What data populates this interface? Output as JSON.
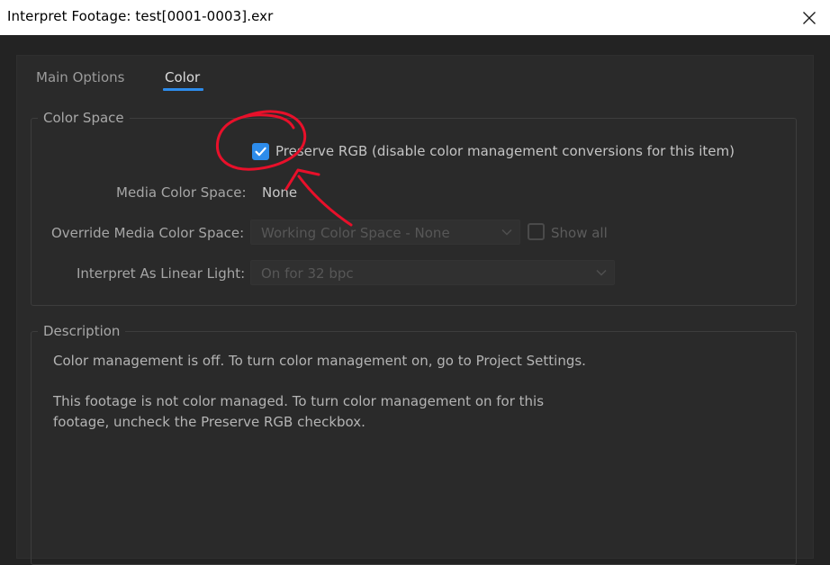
{
  "window": {
    "title": "Interpret Footage: test[0001-0003].exr",
    "close_icon": "close-icon"
  },
  "tabs": [
    {
      "label": "Main Options",
      "active": false
    },
    {
      "label": "Color",
      "active": true
    }
  ],
  "color_space": {
    "legend": "Color Space",
    "preserve_rgb": {
      "label": "Preserve RGB (disable color management conversions for this item)",
      "checked": true
    },
    "media_color_space": {
      "label": "Media Color Space:",
      "value": "None"
    },
    "override_media_color_space": {
      "label": "Override Media Color Space:",
      "selected": "Working Color Space - None",
      "enabled": false,
      "show_all_label": "Show all",
      "show_all_checked": false
    },
    "interpret_as_linear_light": {
      "label": "Interpret As Linear Light:",
      "selected": "On for 32 bpc",
      "enabled": false
    }
  },
  "description": {
    "legend": "Description",
    "line1": "Color management is off. To turn color management on, go to Project Settings.",
    "line2": "This footage is not color managed. To turn color management on for this",
    "line3": "footage, uncheck the Preserve RGB checkbox."
  },
  "colors": {
    "accent": "#2d8ceb",
    "annotation": "#e8102a",
    "background": "#232323",
    "panel": "#2a2a2a"
  }
}
